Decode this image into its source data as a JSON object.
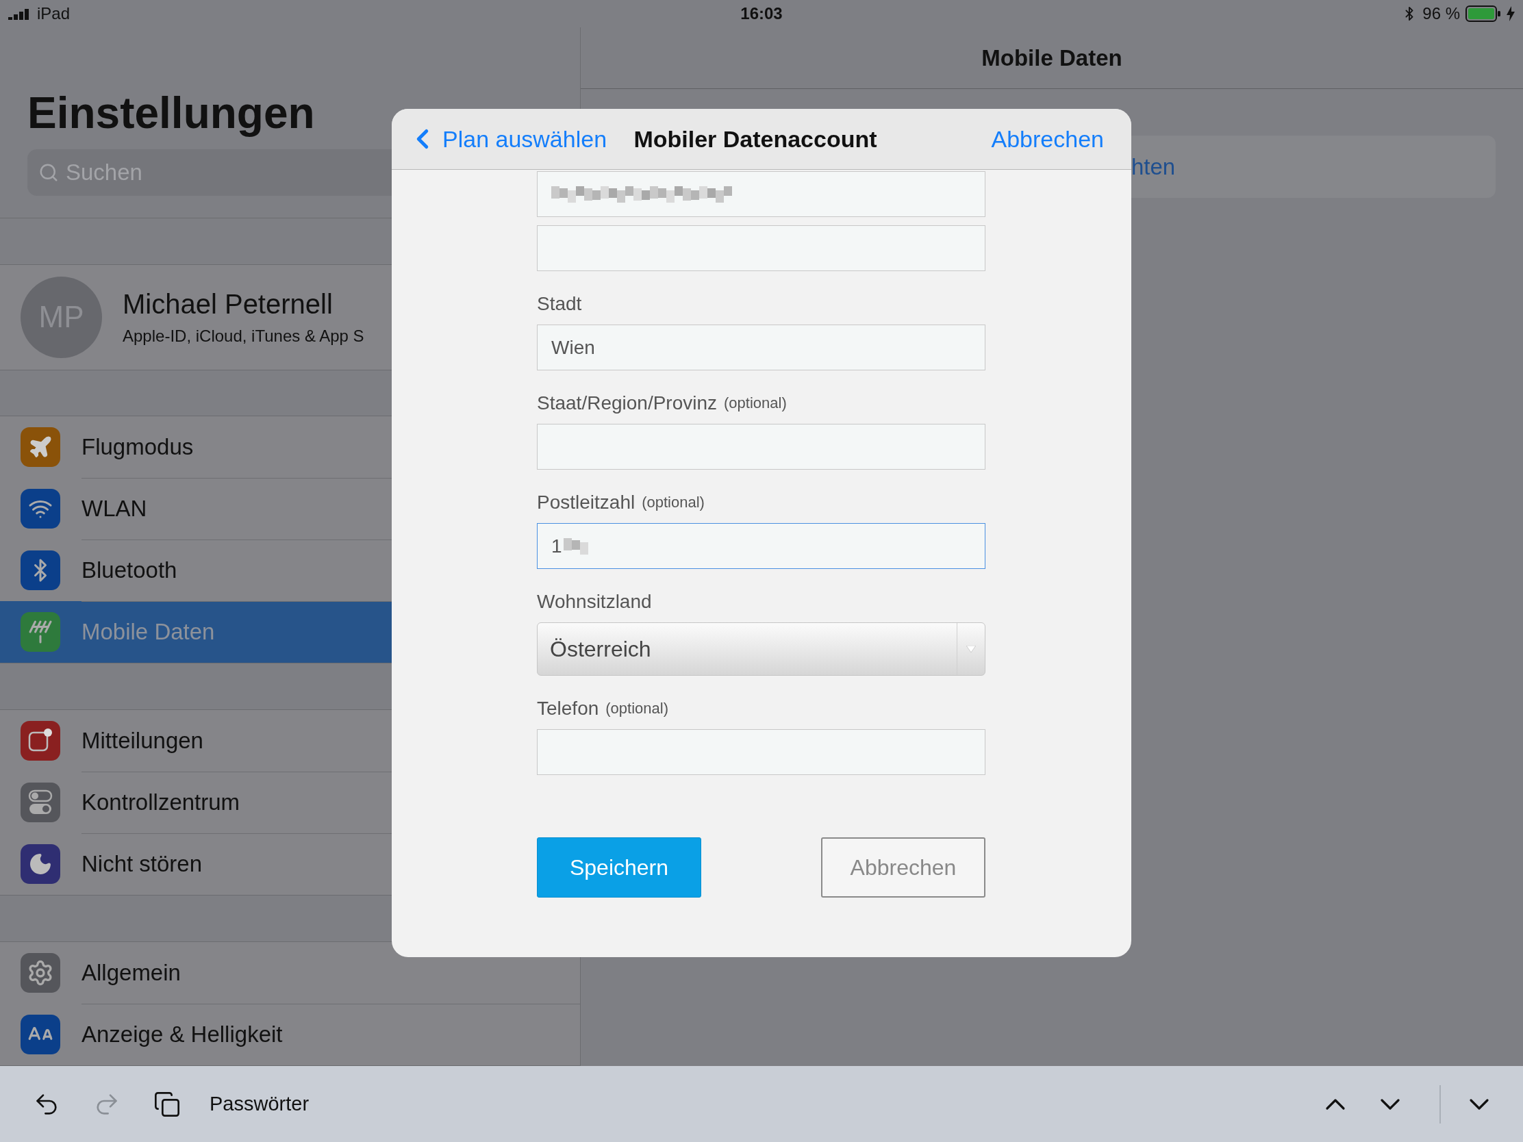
{
  "status_bar": {
    "carrier": "iPad",
    "time": "16:03",
    "battery": "96 %"
  },
  "sidebar": {
    "title": "Einstellungen",
    "search": {
      "placeholder": "Suchen"
    },
    "profile": {
      "initials": "MP",
      "name": "Michael Peternell",
      "subtitle": "Apple-ID, iCloud, iTunes & App S"
    },
    "groups": [
      {
        "items": [
          {
            "label": "Flugmodus",
            "color": "#8a5209",
            "selected": false
          },
          {
            "label": "WLAN",
            "color": "#0b3f8a",
            "selected": false
          },
          {
            "label": "Bluetooth",
            "color": "#0b3f8a",
            "selected": false
          },
          {
            "label": "Mobile Daten",
            "color": "#2e7a3c",
            "selected": true
          }
        ]
      },
      {
        "items": [
          {
            "label": "Mitteilungen",
            "color": "#8a2020",
            "selected": false
          },
          {
            "label": "Kontrollzentrum",
            "color": "#55565b",
            "selected": false
          },
          {
            "label": "Nicht stören",
            "color": "#2f2e72",
            "selected": false
          }
        ]
      },
      {
        "items": [
          {
            "label": "Allgemein",
            "color": "#55565b",
            "selected": false
          },
          {
            "label": "Anzeige & Helligkeit",
            "color": "#0b3f8a",
            "selected": false
          }
        ]
      }
    ]
  },
  "detail": {
    "title": "Mobile Daten",
    "card_text": "hten"
  },
  "modal": {
    "back": "Plan auswählen",
    "title": "Mobiler Datenaccount",
    "cancel": "Abbrechen",
    "fields": [
      {
        "kind": "input",
        "redacted": true,
        "focused": false
      },
      {
        "kind": "input",
        "redacted": false,
        "focused": false
      },
      {
        "kind": "input",
        "label": "Stadt",
        "value": "Wien",
        "redacted": false,
        "focused": false
      },
      {
        "kind": "input",
        "label": "Staat/Region/Provinz",
        "hint": "(optional)",
        "redacted": false,
        "focused": false
      },
      {
        "kind": "input",
        "label": "Postleitzahl",
        "hint": "(optional)",
        "value": "1",
        "redacted": true,
        "focused": true
      },
      {
        "kind": "select",
        "label": "Wohnsitzland",
        "value": "Österreich",
        "focused": false
      },
      {
        "kind": "input",
        "label": "Telefon",
        "hint": "(optional)",
        "redacted": false,
        "focused": false
      }
    ],
    "buttons": [
      {
        "label": "Speichern",
        "kind": "primary"
      },
      {
        "label": "Abbrechen",
        "kind": "secondary"
      }
    ]
  },
  "shortcut_bar": {
    "tools": [
      {
        "disabled": false
      },
      {
        "disabled": true
      },
      {
        "disabled": false
      }
    ],
    "label": "Passwörter"
  }
}
